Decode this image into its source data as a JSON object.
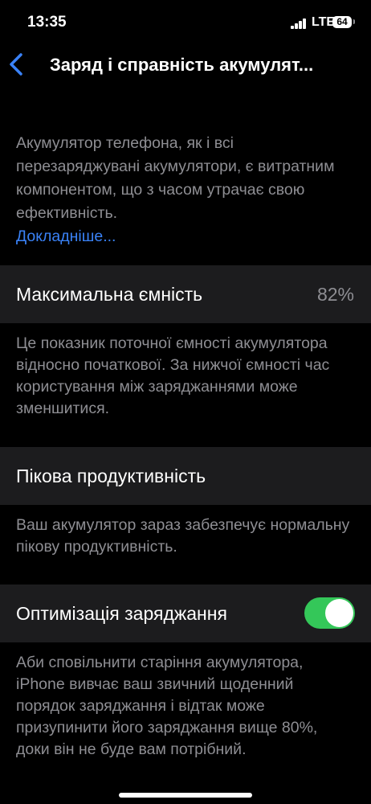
{
  "status_bar": {
    "time": "13:35",
    "network": "LTE",
    "battery": "64"
  },
  "nav": {
    "title": "Заряд і справність акумулят..."
  },
  "intro": {
    "text": "Акумулятор телефона, як і всі перезаряджувані акумулятори, є витратним компонентом, що з часом утрачає свою ефективність.",
    "link": "Докладніше..."
  },
  "max_capacity": {
    "label": "Максимальна ємність",
    "value": "82%",
    "footer": "Це показник поточної ємності акумулятора відносно початкової. За нижчої ємності час користування між заряджаннями може зменшитися."
  },
  "peak_performance": {
    "label": "Пікова продуктивність",
    "footer": "Ваш акумулятор зараз забезпечує нормальну пікову продуктивність."
  },
  "optimized_charging": {
    "label": "Оптимізація заряджання",
    "enabled": true,
    "footer": "Аби сповільнити старіння акумулятора, iPhone вивчає ваш звичний щоденний порядок заряджання і відтак може призупинити його заряджання вище 80%, доки він не буде вам потрібний."
  },
  "colors": {
    "accent": "#3a82f7",
    "toggle_on": "#34c759",
    "cell_bg": "#1c1c1e",
    "secondary_text": "#8e8e93"
  }
}
